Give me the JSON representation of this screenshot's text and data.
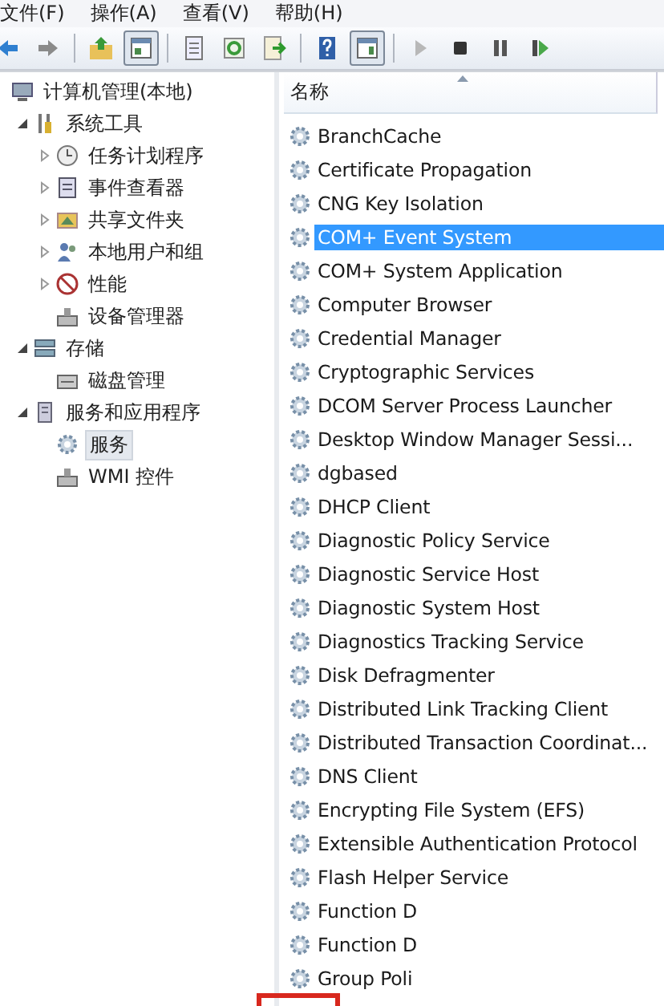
{
  "menu_bar": [
    "文件(F)",
    "操作(A)",
    "查看(V)",
    "帮助(H)"
  ],
  "toolbar": [
    {
      "kind": "back",
      "pressed": false
    },
    {
      "kind": "forward",
      "pressed": false
    },
    {
      "kind": "sep"
    },
    {
      "kind": "up",
      "pressed": false
    },
    {
      "kind": "tree",
      "pressed": true
    },
    {
      "kind": "sep"
    },
    {
      "kind": "props",
      "pressed": false
    },
    {
      "kind": "refresh",
      "pressed": false
    },
    {
      "kind": "export",
      "pressed": false
    },
    {
      "kind": "sep"
    },
    {
      "kind": "help",
      "pressed": false
    },
    {
      "kind": "view",
      "pressed": true
    },
    {
      "kind": "sep"
    },
    {
      "kind": "play",
      "pressed": false
    },
    {
      "kind": "stop",
      "pressed": false
    },
    {
      "kind": "pause",
      "pressed": false
    },
    {
      "kind": "resume",
      "pressed": false
    }
  ],
  "tree": [
    {
      "label": "计算机管理(本地)",
      "selected": false,
      "children": [
        {
          "label": "系统工具",
          "expanded": true,
          "selected": false,
          "children": [
            {
              "label": "任务计划程序",
              "expanded": false,
              "selected": false
            },
            {
              "label": "事件查看器",
              "expanded": false,
              "selected": false
            },
            {
              "label": "共享文件夹",
              "expanded": false,
              "selected": false
            },
            {
              "label": "本地用户和组",
              "expanded": false,
              "selected": false
            },
            {
              "label": "性能",
              "expanded": false,
              "selected": false
            },
            {
              "label": "设备管理器",
              "selected": false
            }
          ]
        },
        {
          "label": "存储",
          "expanded": true,
          "selected": false,
          "children": [
            {
              "label": "磁盘管理",
              "selected": false
            }
          ]
        },
        {
          "label": "服务和应用程序",
          "expanded": true,
          "selected": false,
          "children": [
            {
              "label": "服务",
              "selected": true
            },
            {
              "label": "WMI 控件",
              "selected": false
            }
          ]
        }
      ]
    }
  ],
  "list": {
    "column": "名称",
    "rows": [
      {
        "name": "BranchCache",
        "selected": false
      },
      {
        "name": "Certificate Propagation",
        "selected": false
      },
      {
        "name": "CNG Key Isolation",
        "selected": false
      },
      {
        "name": "COM+ Event System",
        "selected": true
      },
      {
        "name": "COM+ System Application",
        "selected": false
      },
      {
        "name": "Computer Browser",
        "selected": false
      },
      {
        "name": "Credential Manager",
        "selected": false
      },
      {
        "name": "Cryptographic Services",
        "selected": false
      },
      {
        "name": "DCOM Server Process Launcher",
        "selected": false
      },
      {
        "name": "Desktop Window Manager Sessi...",
        "selected": false
      },
      {
        "name": "dgbased",
        "selected": false
      },
      {
        "name": "DHCP Client",
        "selected": false
      },
      {
        "name": "Diagnostic Policy Service",
        "selected": false
      },
      {
        "name": "Diagnostic Service Host",
        "selected": false
      },
      {
        "name": "Diagnostic System Host",
        "selected": false
      },
      {
        "name": "Diagnostics Tracking Service",
        "selected": false
      },
      {
        "name": "Disk Defragmenter",
        "selected": false
      },
      {
        "name": "Distributed Link Tracking Client",
        "selected": false
      },
      {
        "name": "Distributed Transaction Coordinat...",
        "selected": false
      },
      {
        "name": "DNS Client",
        "selected": false
      },
      {
        "name": "Encrypting File System (EFS)",
        "selected": false
      },
      {
        "name": "Extensible Authentication Protocol",
        "selected": false
      },
      {
        "name": "Flash Helper Service",
        "selected": false
      },
      {
        "name": "Function D",
        "selected": false
      },
      {
        "name": "Function D",
        "selected": false
      },
      {
        "name": "Group Poli",
        "selected": false
      }
    ]
  },
  "annotation": {
    "kind": "frame"
  }
}
